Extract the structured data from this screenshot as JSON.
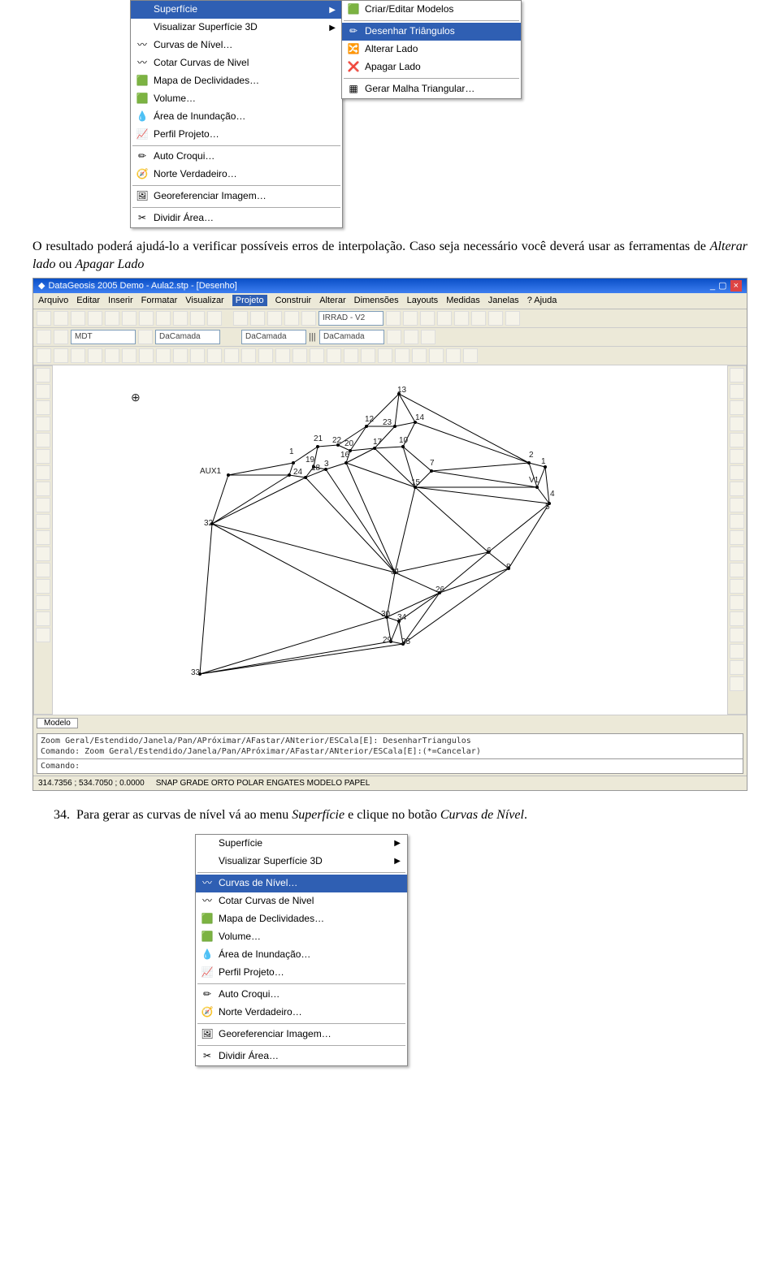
{
  "menu1": {
    "items": [
      {
        "icon": "",
        "label": "Superfície",
        "arrow": "▶",
        "hl": true
      },
      {
        "icon": "",
        "label": "Visualizar Superfície 3D",
        "arrow": "▶"
      },
      {
        "icon": "〰",
        "label": "Curvas de Nível…"
      },
      {
        "icon": "〰",
        "label": "Cotar Curvas de Nivel"
      },
      {
        "icon": "🟩",
        "label": "Mapa de Declividades…"
      },
      {
        "icon": "🟩",
        "label": "Volume…"
      },
      {
        "icon": "💧",
        "label": "Área de Inundação…"
      },
      {
        "icon": "📈",
        "label": "Perfil Projeto…"
      },
      {
        "sep": true
      },
      {
        "icon": "✏",
        "label": "Auto Croqui…"
      },
      {
        "icon": "🧭",
        "label": "Norte Verdadeiro…"
      },
      {
        "sep": true
      },
      {
        "icon": "🖼",
        "label": "Georeferenciar Imagem…"
      },
      {
        "sep": true
      },
      {
        "icon": "✂",
        "label": "Dividir Área…"
      }
    ]
  },
  "submenu1": {
    "items": [
      {
        "icon": "🟩",
        "label": "Criar/Editar Modelos"
      },
      {
        "sep": true
      },
      {
        "icon": "✏",
        "label": "Desenhar Triângulos",
        "hl": true
      },
      {
        "icon": "🔀",
        "label": "Alterar Lado"
      },
      {
        "icon": "❌",
        "label": "Apagar Lado"
      },
      {
        "sep": true
      },
      {
        "icon": "▦",
        "label": "Gerar Malha Triangular…"
      }
    ]
  },
  "para1": "O resultado poderá ajudá-lo a verificar possíveis erros de interpolação. Caso seja necessário você deverá usar as ferramentas de ",
  "para1_it1": "Alterar lado",
  "para1_mid": " ou ",
  "para1_it2": "Apagar Lado",
  "app": {
    "title": "DataGeosis 2005 Demo - Aula2.stp - [Desenho]",
    "menus": [
      "Arquivo",
      "Editar",
      "Inserir",
      "Formatar",
      "Visualizar",
      "Projeto",
      "Construir",
      "Alterar",
      "Dimensões",
      "Layouts",
      "Medidas",
      "Janelas",
      "? Ajuda"
    ],
    "menus_hl_index": 5,
    "combo1": "MDT",
    "combo2": "DaCamada",
    "combo3": "DaCamada",
    "combo4": "IRRAD - V2",
    "combo5": "DaCamada",
    "tab": "Modelo",
    "cmd1": "Zoom Geral/Estendido/Janela/Pan/APróximar/AFastar/ANterior/ESCala[E]: DesenharTriangulos",
    "cmd2": "Comando: Zoom Geral/Estendido/Janela/Pan/APróximar/AFastar/ANterior/ESCala[E]:(*=Cancelar)",
    "cmd3": "Comando:",
    "coords": "314.7356 ; 534.7050 ; 0.0000",
    "flags": "SNAP  GRADE  ORTO  POLAR  ENGATES  MODELO  PAPEL",
    "points": [
      "13",
      "14",
      "12",
      "23",
      "21",
      "22",
      "20",
      "1",
      "19",
      "16",
      "17",
      "10",
      "7",
      "18",
      "24",
      "AUX1",
      "3",
      "2",
      "15",
      "1",
      "V1",
      "4",
      "5",
      "32",
      "6",
      "31",
      "26",
      "8",
      "30",
      "34",
      "29",
      "25",
      "33"
    ]
  },
  "step34": {
    "num": "34.",
    "text1": "Para gerar as curvas de nível vá ao menu ",
    "it1": "Superfície",
    "mid": " e clique no botão ",
    "it2": "Curvas de Nível",
    "end": "."
  },
  "menu2": {
    "items": [
      {
        "icon": "",
        "label": "Superfície",
        "arrow": "▶"
      },
      {
        "icon": "",
        "label": "Visualizar Superfície 3D",
        "arrow": "▶"
      },
      {
        "sep": true
      },
      {
        "icon": "〰",
        "label": "Curvas de Nível…",
        "hl": true
      },
      {
        "icon": "〰",
        "label": "Cotar Curvas de Nivel"
      },
      {
        "icon": "🟩",
        "label": "Mapa de Declividades…"
      },
      {
        "icon": "🟩",
        "label": "Volume…"
      },
      {
        "icon": "💧",
        "label": "Área de Inundação…"
      },
      {
        "icon": "📈",
        "label": "Perfil Projeto…"
      },
      {
        "sep": true
      },
      {
        "icon": "✏",
        "label": "Auto Croqui…"
      },
      {
        "icon": "🧭",
        "label": "Norte Verdadeiro…"
      },
      {
        "sep": true
      },
      {
        "icon": "🖼",
        "label": "Georeferenciar Imagem…"
      },
      {
        "sep": true
      },
      {
        "icon": "✂",
        "label": "Dividir Área…"
      }
    ]
  }
}
